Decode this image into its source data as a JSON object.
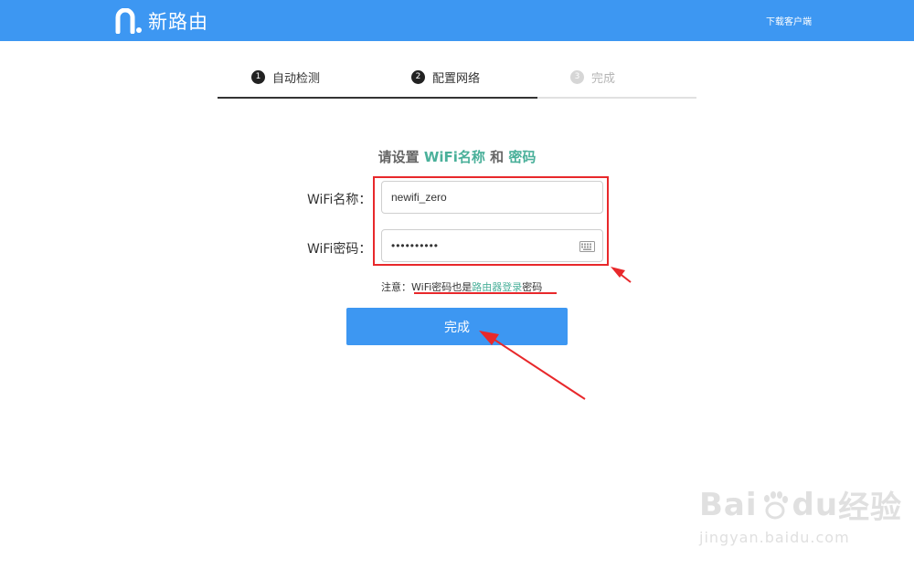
{
  "header": {
    "logo_text": "新路由",
    "download_link": "下载客户端"
  },
  "steps": [
    {
      "num": "1",
      "label": "自动检测",
      "state": "done"
    },
    {
      "num": "2",
      "label": "配置网络",
      "state": "active"
    },
    {
      "num": "3",
      "label": "完成",
      "state": "pending"
    }
  ],
  "form": {
    "heading": {
      "prefix": "请设置 ",
      "wifi_name": "WiFi名称",
      "and": " 和 ",
      "password": "密码"
    },
    "name_label": "WiFi名称：",
    "name_value": "newifi_zero",
    "password_label": "WiFi密码：",
    "password_value": "••••••••••",
    "note": {
      "prefix": "注意：",
      "text1": "WiFi密码也是",
      "link": "路由器登录",
      "text2": "密码"
    },
    "submit_label": "完成"
  },
  "watermark": {
    "main_prefix": "Bai",
    "main_suffix": "经验",
    "main_du": "du",
    "sub": "jingyan.baidu.com"
  },
  "colors": {
    "brand": "#3d97f2",
    "accent": "#4ab09a",
    "annotation": "#e8282b"
  }
}
